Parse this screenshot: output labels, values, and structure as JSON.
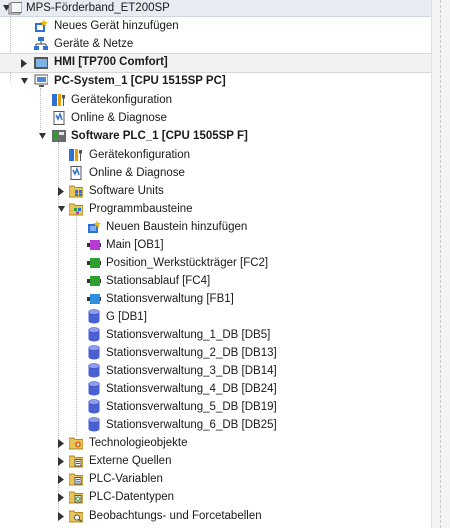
{
  "project": {
    "name": "MPS-Förderband_ET200SP"
  },
  "tree": {
    "add_device": "Neues Gerät hinzufügen",
    "devices_networks": "Geräte & Netze",
    "hmi": "HMI [TP700 Comfort]",
    "pc_system": "PC-System_1 [CPU 1515SP PC]",
    "pc_device_config": "Gerätekonfiguration",
    "pc_online_diag": "Online & Diagnose",
    "software_plc": "Software PLC_1 [CPU 1505SP F]",
    "plc_device_config": "Gerätekonfiguration",
    "plc_online_diag": "Online & Diagnose",
    "software_units": "Software Units",
    "program_blocks": "Programmbausteine",
    "blocks": [
      {
        "label": "Neuen Baustein hinzufügen",
        "icon": "add-block-icon",
        "color": "#2f6fd6"
      },
      {
        "label": "Main [OB1]",
        "icon": "ob-block-icon",
        "color": "#b83ad4"
      },
      {
        "label": "Position_Werkstückträger [FC2]",
        "icon": "fc-block-icon",
        "color": "#2ea02e"
      },
      {
        "label": "Stationsablauf [FC4]",
        "icon": "fc-block-icon",
        "color": "#2ea02e"
      },
      {
        "label": "Stationsverwaltung [FB1]",
        "icon": "fb-block-icon",
        "color": "#2f8ee0"
      },
      {
        "label": "G [DB1]",
        "icon": "db-icon",
        "color": "#4a5fd0"
      },
      {
        "label": "Stationsverwaltung_1_DB [DB5]",
        "icon": "db-icon",
        "color": "#4a5fd0"
      },
      {
        "label": "Stationsverwaltung_2_DB [DB13]",
        "icon": "db-icon",
        "color": "#4a5fd0"
      },
      {
        "label": "Stationsverwaltung_3_DB [DB14]",
        "icon": "db-icon",
        "color": "#4a5fd0"
      },
      {
        "label": "Stationsverwaltung_4_DB [DB24]",
        "icon": "db-icon",
        "color": "#4a5fd0"
      },
      {
        "label": "Stationsverwaltung_5_DB [DB19]",
        "icon": "db-icon",
        "color": "#4a5fd0"
      },
      {
        "label": "Stationsverwaltung_6_DB [DB25]",
        "icon": "db-icon",
        "color": "#4a5fd0"
      }
    ],
    "technology_objects": "Technologieobjekte",
    "external_sources": "Externe Quellen",
    "plc_variables": "PLC-Variablen",
    "plc_datatypes": "PLC-Datentypen",
    "watch_force_tables": "Beobachtungs- und Forcetabellen"
  }
}
